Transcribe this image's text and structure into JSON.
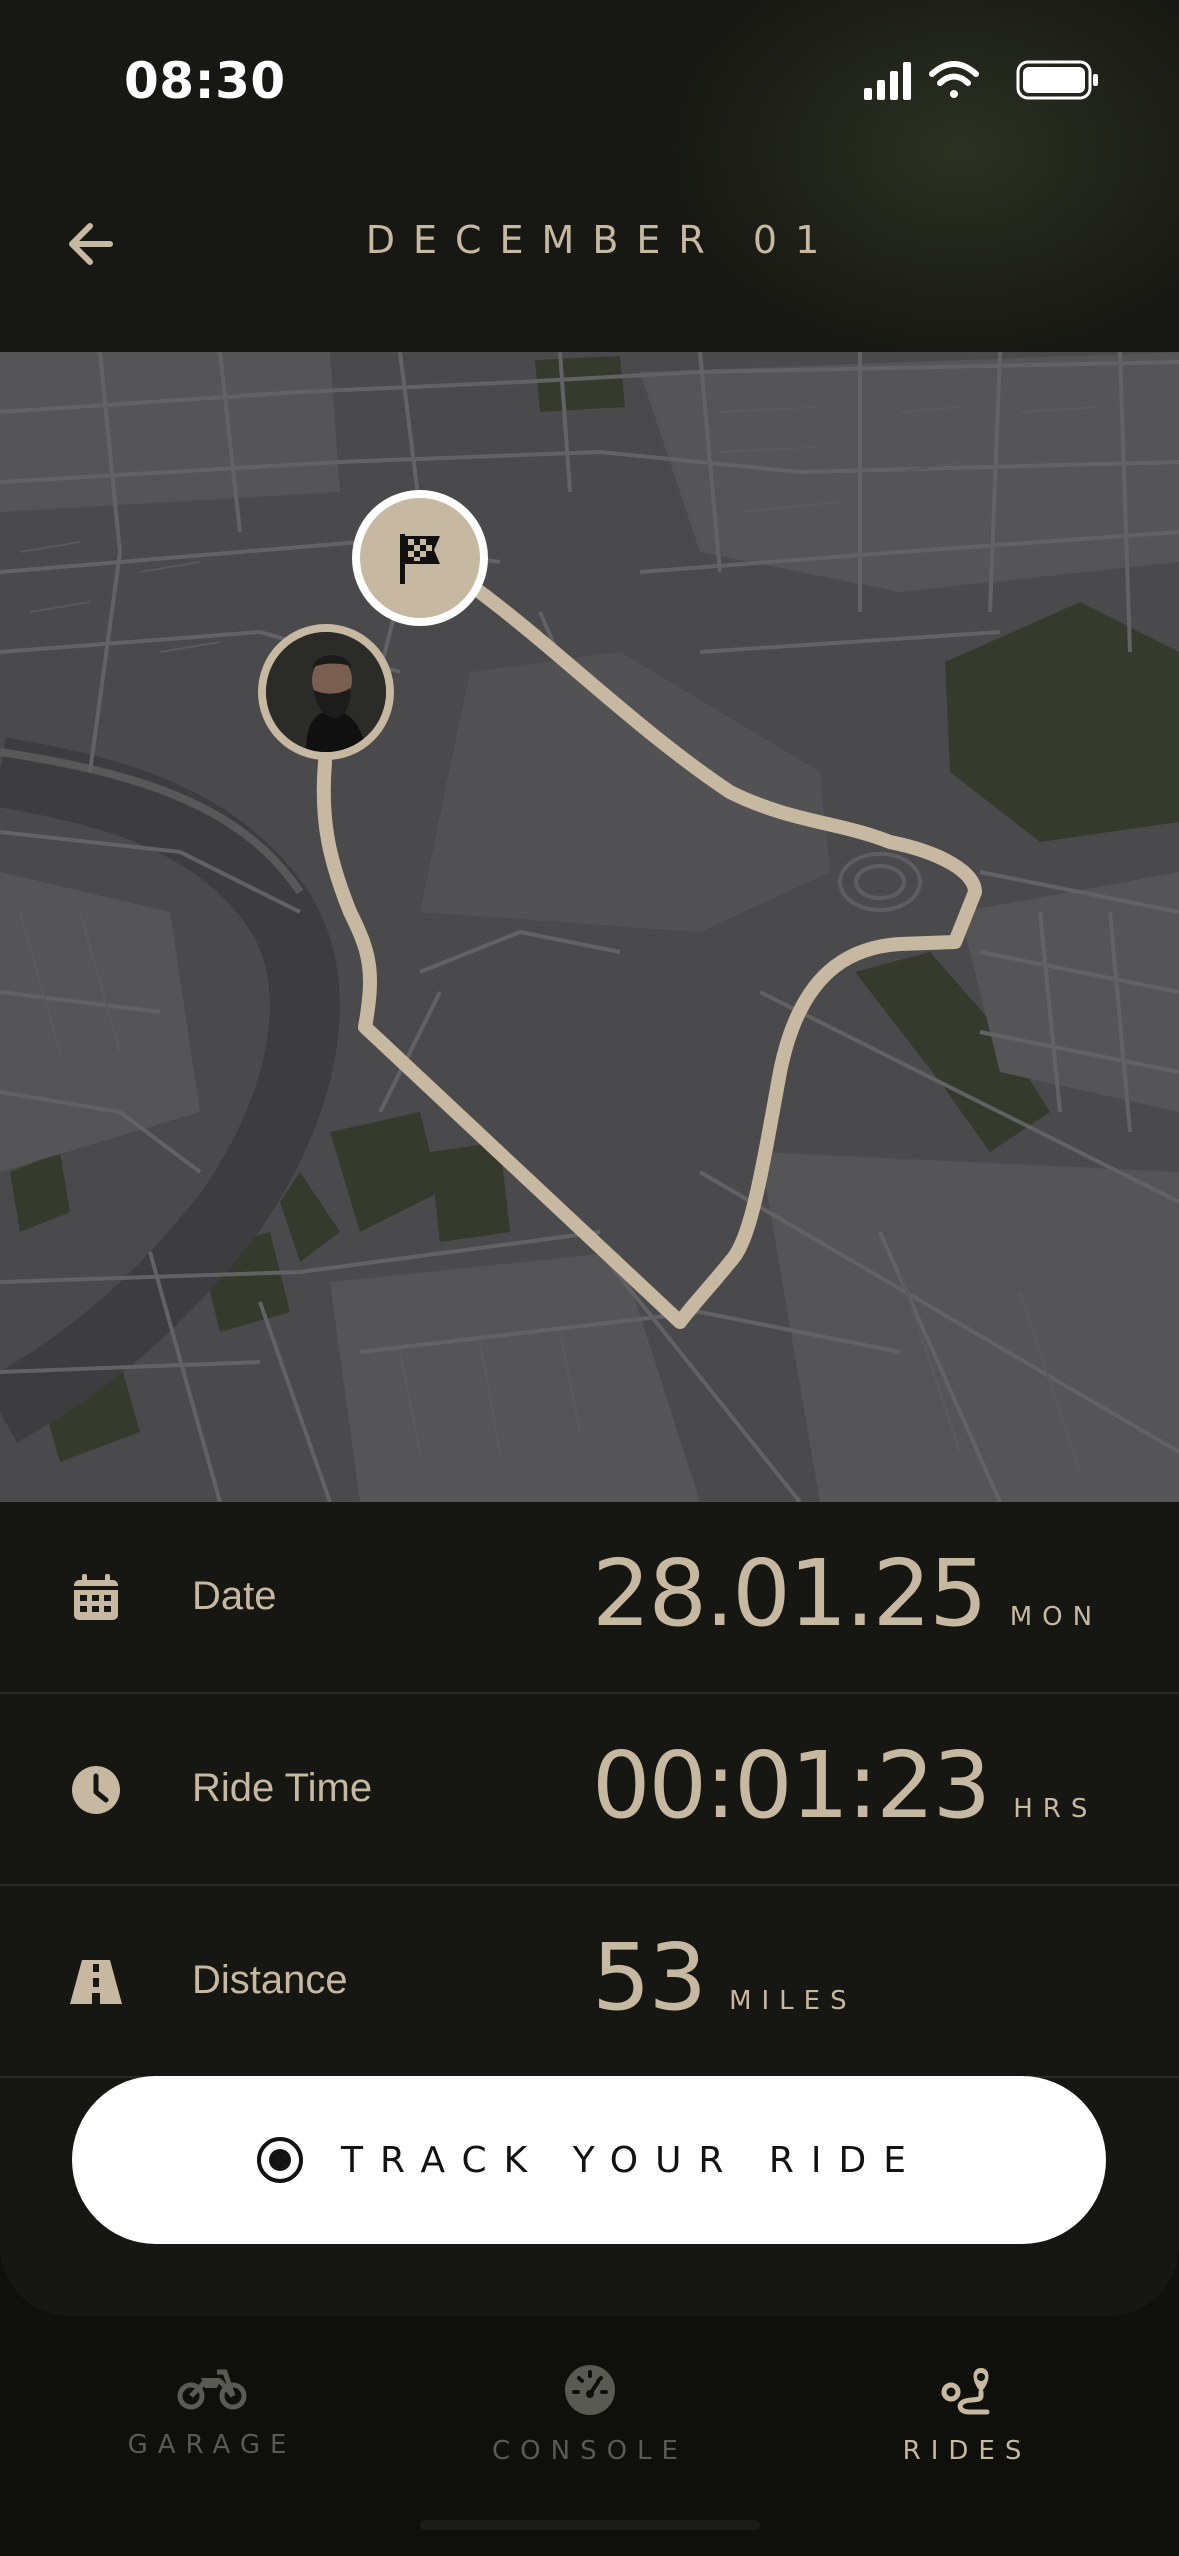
{
  "status_bar": {
    "time": "08:30"
  },
  "header": {
    "title": "DECEMBER 01"
  },
  "map": {
    "start_marker_icon": "checkered-flag-icon",
    "rider_marker": "rider-avatar"
  },
  "stats": [
    {
      "icon": "calendar-icon",
      "label": "Date",
      "value": "28.01.25",
      "unit": "MON"
    },
    {
      "icon": "clock-icon",
      "label": "Ride Time",
      "value": "00:01:23",
      "unit": "HRS"
    },
    {
      "icon": "road-icon",
      "label": "Distance",
      "value": "53",
      "unit": "MILES"
    }
  ],
  "track_button": {
    "label": "TRACK YOUR RIDE",
    "icon": "record-icon"
  },
  "tabs": [
    {
      "label": "GARAGE",
      "icon": "motorcycle-icon",
      "active": false
    },
    {
      "label": "CONSOLE",
      "icon": "speedometer-icon",
      "active": false
    },
    {
      "label": "RIDES",
      "icon": "route-icon",
      "active": true
    }
  ],
  "colors": {
    "accent": "#c7b9a1",
    "background": "#0f100c",
    "panel": "#161712",
    "map_base": "#4a4a4c",
    "map_roads": "#5e5e60",
    "map_parks": "#353a2c",
    "inactive_tab": "#5a5a55"
  }
}
